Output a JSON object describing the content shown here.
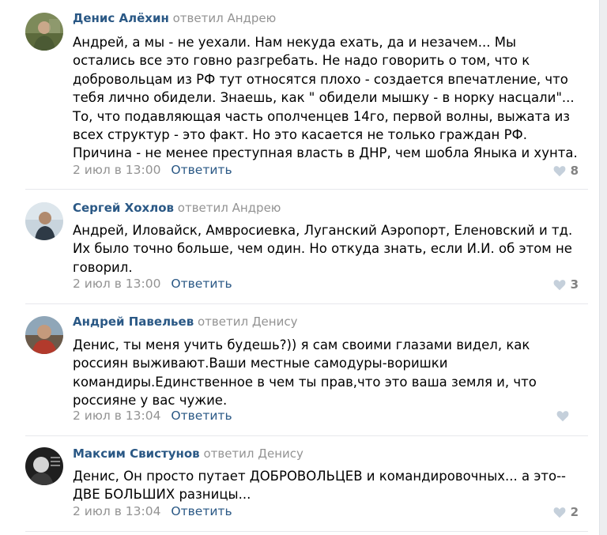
{
  "comments": [
    {
      "author": "Денис Алёхин",
      "replied": "ответил Андрею",
      "lines": [
        "Андрей, а мы - не уехали. Нам некуда ехать, да и незачем... Мы",
        "остались все это говно разгребать. Не надо говорить о том, что к",
        "добровольцам из РФ тут относятся плохо - создается впечатление, что",
        "тебя лично обидели. Знаешь, как \" обидели мышку - в норку насцали\"...",
        "То, что подавляющая часть ополченцев 14го, первой волны, выжата из",
        "всех структур - это факт. Но это касается не только граждан РФ.",
        "Причина - не менее преступная власть в ДНР, чем шобла Яныка и хунта."
      ],
      "date": "2 июл в 13:00",
      "reply": "Ответить",
      "likes": "8"
    },
    {
      "author": "Сергей Хохлов",
      "replied": "ответил Андрею",
      "lines": [
        "Андрей, Иловайск, Амвросиевка, Луганский Аэропорт, Еленовский и тд.",
        "Их было точно больше, чем один. Но откуда знать, если И.И. об этом не",
        "говорил."
      ],
      "date": "2 июл в 13:00",
      "reply": "Ответить",
      "likes": "3"
    },
    {
      "author": "Андрей Павельев",
      "replied": "ответил Денису",
      "lines": [
        "Денис, ты меня учить будешь?)) я сам своими глазами видел, как",
        "россиян выживают.Ваши местные самодуры-воришки",
        "командиры.Единственное в чем ты прав,что это ваша земля и, что",
        "россияне у вас чужие."
      ],
      "date": "2 июл в 13:04",
      "reply": "Ответить",
      "likes": ""
    },
    {
      "author": "Максим Свистунов",
      "replied": "ответил Денису",
      "lines": [
        "Денис, Он просто путает ДОБРОВОЛЬЦЕВ и командировочных... а это--",
        "ДВЕ БОЛЬШИХ разницы..."
      ],
      "date": "2 июл в 13:04",
      "reply": "Ответить",
      "likes": "2"
    }
  ]
}
